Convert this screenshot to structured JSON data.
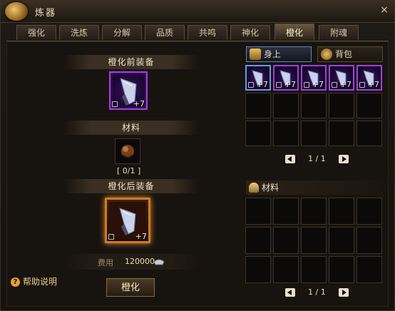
{
  "window": {
    "title": "炼器",
    "close_glyph": "×"
  },
  "tabs": [
    {
      "label": "强化"
    },
    {
      "label": "洗炼"
    },
    {
      "label": "分解"
    },
    {
      "label": "品质"
    },
    {
      "label": "共鸣"
    },
    {
      "label": "神化"
    },
    {
      "label": "橙化",
      "active": true
    },
    {
      "label": "附魂"
    }
  ],
  "left": {
    "before_label": "橙化前装备",
    "before_item": {
      "plus": "+7",
      "quality": "purple"
    },
    "material_label": "材料",
    "material_count": "[ 0/1 ]",
    "after_label": "橙化后装备",
    "after_item": {
      "plus": "+7",
      "quality": "orange"
    },
    "cost_label": "费用",
    "cost_value": "120000",
    "help_icon": "?",
    "help_text": "帮助说明",
    "action_button": "橙化"
  },
  "right": {
    "tab_equipped": "身上",
    "tab_bag": "背包",
    "equipped_items": [
      {
        "plus": "+7",
        "selected": true
      },
      {
        "plus": "+7"
      },
      {
        "plus": "+7"
      },
      {
        "plus": "+7"
      },
      {
        "plus": "+7"
      }
    ],
    "equip_pager": "1 / 1",
    "material_header": "材料",
    "material_pager": "1 / 1"
  },
  "colors": {
    "purple_quality": "#a040d8",
    "orange_quality": "#d07a20",
    "accent_gold": "#f0d08a"
  }
}
